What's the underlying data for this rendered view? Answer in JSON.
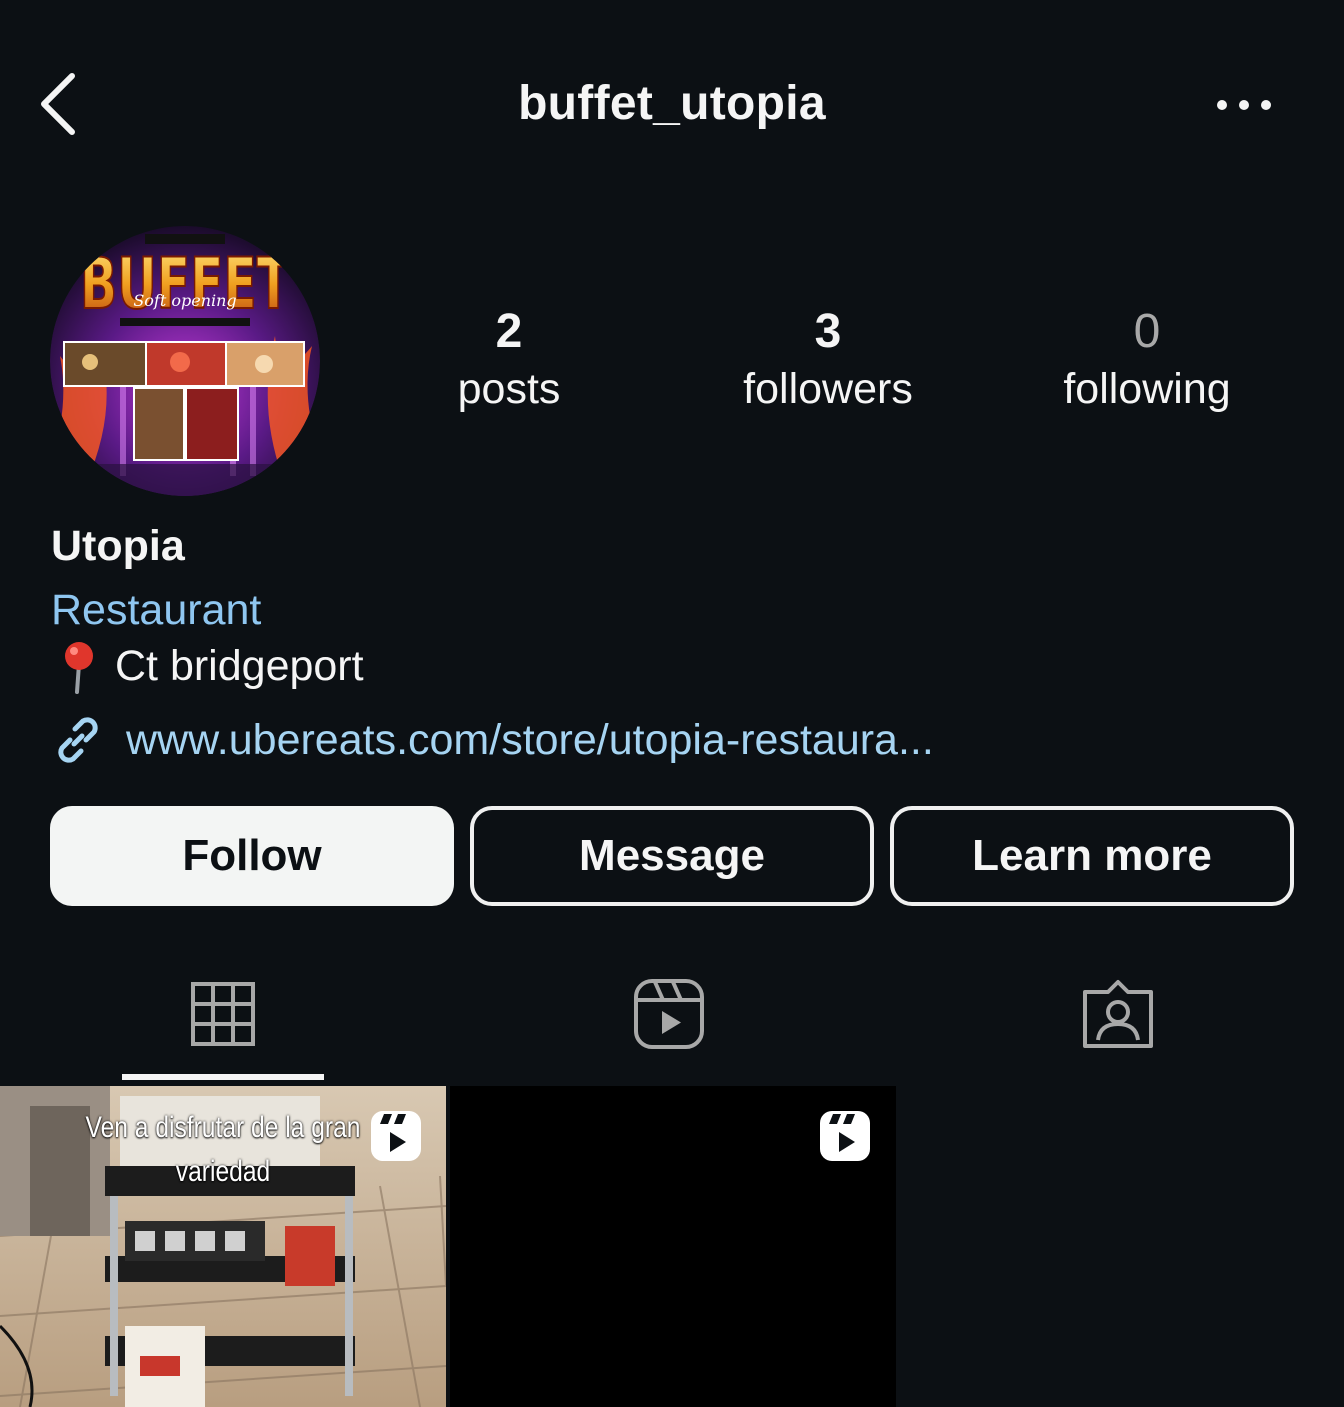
{
  "header": {
    "username": "buffet_utopia",
    "back_icon": "chevron-left-icon",
    "more_icon": "more-horizontal-icon"
  },
  "profile": {
    "avatar_alt": "BUFFET",
    "stats": [
      {
        "value": "2",
        "label": "posts"
      },
      {
        "value": "3",
        "label": "followers"
      },
      {
        "value": "0",
        "label": "following"
      }
    ],
    "display_name": "Utopia",
    "category": "Restaurant",
    "location": "Ct bridgeport",
    "link": "www.ubereats.com/store/utopia-restaura..."
  },
  "buttons": {
    "follow": "Follow",
    "message": "Message",
    "learn_more": "Learn more"
  },
  "tabs": [
    {
      "icon": "grid-icon",
      "active": true
    },
    {
      "icon": "reels-icon",
      "active": false
    },
    {
      "icon": "tagged-icon",
      "active": false
    }
  ],
  "posts": [
    {
      "caption_line1": "Ven a disfrutar de la gran",
      "caption_line2": "variedad",
      "type": "reel"
    },
    {
      "caption_line1": "",
      "caption_line2": "",
      "type": "reel"
    }
  ],
  "colors": {
    "background": "#0c1014",
    "link": "#a6d4f2",
    "category": "#8fc6f0",
    "follow_button": "#f3f5f4"
  }
}
